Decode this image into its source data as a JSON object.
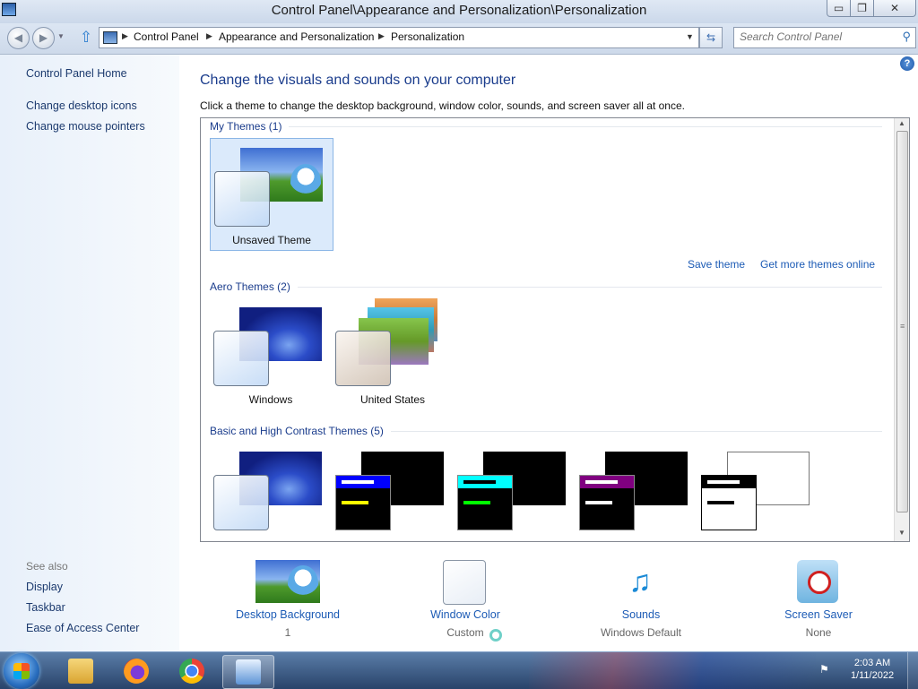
{
  "window": {
    "title": "Control Panel\\Appearance and Personalization\\Personalization",
    "min_glyph": "▭",
    "max_glyph": "❐",
    "close_glyph": "✕"
  },
  "nav": {
    "back_glyph": "◀",
    "forward_glyph": "▶",
    "dropdown_glyph": "▼",
    "up_glyph": "⇧",
    "refresh_glyph": "⇆",
    "crumb_sep": "▶",
    "breadcrumbs": [
      "Control Panel",
      "Appearance and Personalization",
      "Personalization"
    ],
    "search_placeholder": "Search Control Panel",
    "search_glyph": "⚲"
  },
  "sidebar": {
    "links": [
      "Control Panel Home",
      "Change desktop icons",
      "Change mouse pointers"
    ],
    "see_also_label": "See also",
    "see_also": [
      "Display",
      "Taskbar",
      "Ease of Access Center"
    ]
  },
  "main": {
    "help_glyph": "?",
    "heading": "Change the visuals and sounds on your computer",
    "subtitle": "Click a theme to change the desktop background, window color, sounds, and screen saver all at once.",
    "groups": {
      "my_themes": "My Themes (1)",
      "aero_themes": "Aero Themes (2)",
      "basic_themes": "Basic and High Contrast Themes (5)"
    },
    "my_themes": [
      "Unsaved Theme"
    ],
    "aero_themes": [
      "Windows",
      "United States"
    ],
    "links": {
      "save_theme": "Save theme",
      "more_themes": "Get more themes online"
    },
    "high_contrast_colors": [
      "#0000ff",
      "#00ffff",
      "#800080",
      "#ffffff"
    ],
    "scroll": {
      "up_glyph": "▲",
      "down_glyph": "▼",
      "grip_glyph": "≡"
    }
  },
  "settings": [
    {
      "name": "Desktop Background",
      "value": "1"
    },
    {
      "name": "Window Color",
      "value": "Custom"
    },
    {
      "name": "Sounds",
      "value": "Windows Default"
    },
    {
      "name": "Screen Saver",
      "value": "None"
    }
  ],
  "taskbar": {
    "time": "2:03 AM",
    "date": "1/11/2022",
    "tray_glyph": "⚑"
  }
}
